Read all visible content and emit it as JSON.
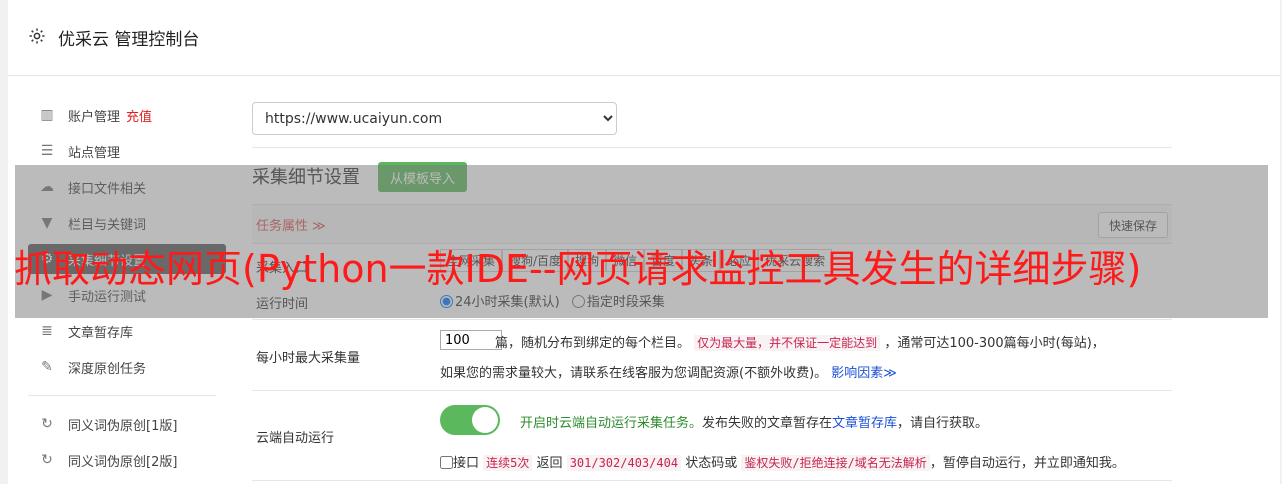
{
  "header": {
    "title": "优采云 管理控制台"
  },
  "sidebar": {
    "items": [
      {
        "label": "账户管理",
        "extra": "充值"
      },
      {
        "label": "站点管理"
      },
      {
        "label": "接口文件相关"
      },
      {
        "label": "栏目与关键词"
      },
      {
        "label": "采集细节设置"
      },
      {
        "label": "手动运行测试"
      },
      {
        "label": "文章暂存库"
      },
      {
        "label": "深度原创任务"
      },
      {
        "label": "同义词伪原创[1版]"
      },
      {
        "label": "同义词伪原创[2版]"
      }
    ]
  },
  "site_select": {
    "value": "https://www.ucaiyun.com"
  },
  "section": {
    "title": "采集细节设置",
    "import_button": "从模板导入"
  },
  "attr_bar": {
    "label": "任务属性 ≫",
    "save_button": "快速保存"
  },
  "rows": {
    "collect_entry": {
      "label": "采集入口",
      "tabs": [
        "全网采集",
        "搜狗/百度",
        "搜狗",
        "微信",
        "百度",
        "头条",
        "必应",
        "优采云搜索"
      ]
    },
    "run_time": {
      "label": "运行时间",
      "opt1": "24小时采集(默认)",
      "opt2": "指定时段采集"
    },
    "max_per_hour": {
      "label": "每小时最大采集量",
      "value": "100",
      "text1": "篇，随机分布到绑定的每个栏目。",
      "code1": "仅为最大量，并不保证一定能达到",
      "text2": "，通常可达100-300篇每小时(每站)，",
      "text3": "如果您的需求量较大，请联系在线客服为您调配资源(不额外收费)。",
      "link": "影响因素≫"
    },
    "cloud_run": {
      "label": "云端自动运行",
      "green": "开启时云端自动运行采集任务。",
      "text1": "发布失败的文章暂存在",
      "link": "文章暂存库",
      "text2": "，请自行获取。",
      "cb_label": "接口",
      "code1": "连续5次",
      "text3": "返回",
      "code2": "301/302/403/404",
      "text4": "状态码或",
      "code3": "鉴权失败/拒绝连接/域名无法解析",
      "text5": "，暂停自动运行，并立即通知我。"
    }
  },
  "overlay_title": "抓取动态网页(Python一款IDE--网页请求监控工具发生的详细步骤)"
}
